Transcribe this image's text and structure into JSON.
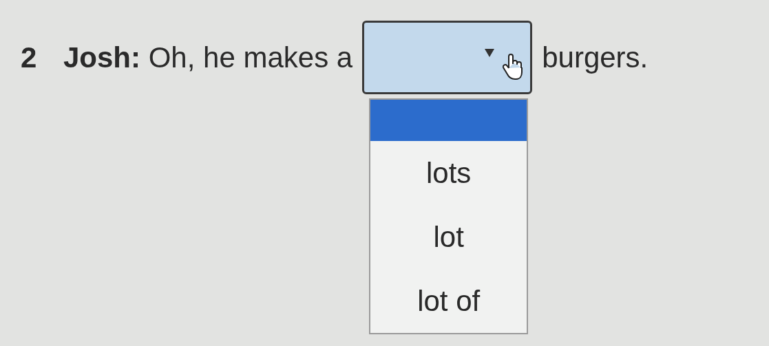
{
  "question": {
    "number": "2",
    "text_before": "**Josh:** Oh, he makes a",
    "text_after": "burgers."
  },
  "dropdown": {
    "expanded": true
  },
  "options": [
    {
      "selected": true
    },
    {
      "label": "lots",
      "selected": false
    },
    {
      "label": "lot",
      "selected": false
    },
    {
      "label": "lot of",
      "selected": false
    }
  ]
}
